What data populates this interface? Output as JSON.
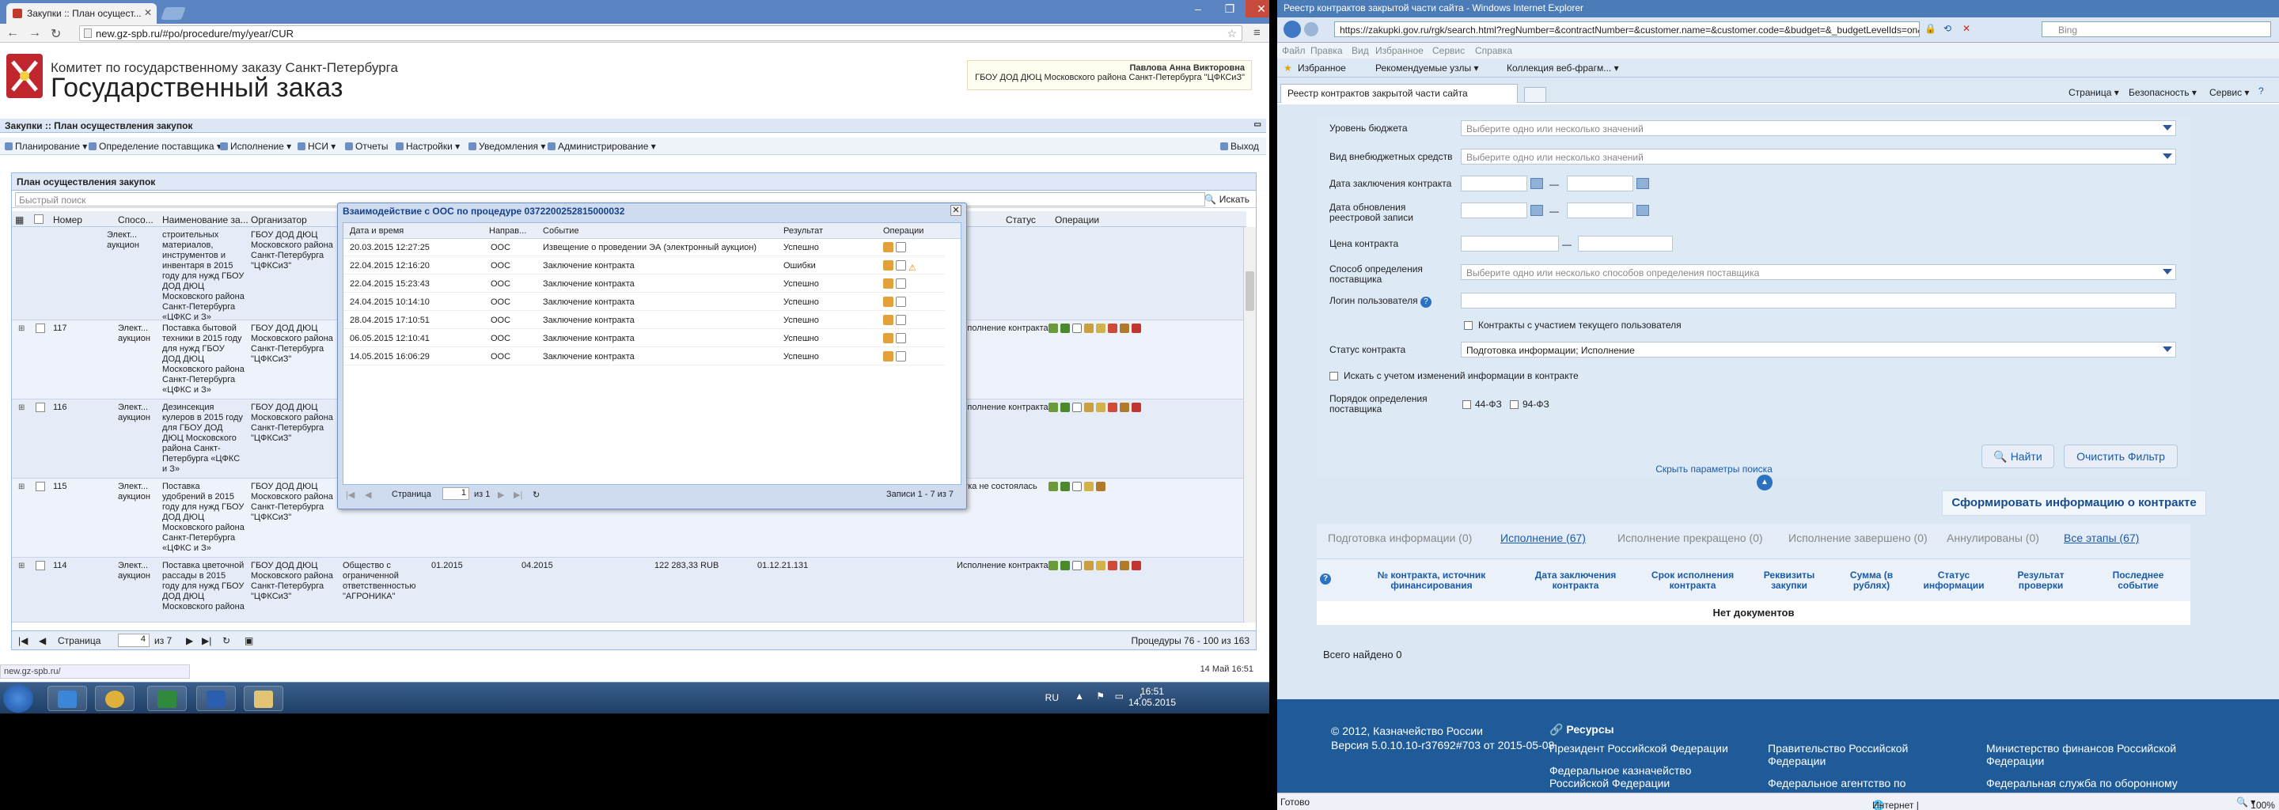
{
  "left_browser": {
    "tab_title": "Закупки :: План осущест...",
    "url": "new.gz-spb.ru/#po/procedure/my/year/CUR",
    "site": {
      "title_top": "Комитет по государственному заказу Санкт-Петербурга",
      "title_main": "Государственный заказ",
      "user_name": "Павлова Анна Викторовна",
      "user_org": "ГБОУ ДОД ДЮЦ Московского района Санкт-Петербурга \"ЦФКСиЗ\""
    },
    "app_title": "Закупки :: План осуществления закупок",
    "menu": [
      "Планирование",
      "Определение поставщика",
      "Исполнение",
      "НСИ",
      "Отчеты",
      "Настройки",
      "Уведомления",
      "Администрирование"
    ],
    "exit_label": "Выход",
    "panel_title": "План осуществления закупок",
    "quick_search_placeholder": "Быстрый поиск",
    "search_btn": "Искать",
    "grid_headers": [
      "Номер",
      "Спосо...",
      "Наименование за...",
      "Организатор",
      "Статус",
      "Операции"
    ],
    "rows": [
      {
        "num": "",
        "method": "Элект... аукцион",
        "name": "строительных материалов, инструментов и инвентаря в 2015 году для нужд ГБОУ ДОД ДЮЦ Московского района Санкт-Петербурга «ЦФКС и З»",
        "org": "ГБОУ ДОД ДЮЦ Московского района Санкт-Петербурга \"ЦФКСиЗ\"",
        "d1": "",
        "d2": "",
        "sum": "",
        "okpd": "",
        "status": ""
      },
      {
        "num": "117",
        "method": "Элект... аукцион",
        "name": "Поставка бытовой техники в 2015 году для нужд ГБОУ ДОД ДЮЦ Московского района Санкт-Петербурга «ЦФКС и З»",
        "org": "ГБОУ ДОД ДЮЦ Московского района Санкт-Петербурга \"ЦФКСиЗ\"",
        "d1": "",
        "d2": "",
        "sum": "",
        "okpd": "",
        "status": "Исполнение контракта"
      },
      {
        "num": "116",
        "method": "Элект... аукцион",
        "name": "Дезинсекция кулеров в 2015 году для ГБОУ ДОД ДЮЦ Московского района Санкт-Петербурга «ЦФКС и З»",
        "org": "ГБОУ ДОД ДЮЦ Московского района Санкт-Петербурга \"ЦФКСиЗ\"",
        "d1": "",
        "d2": "",
        "sum": "",
        "okpd": "",
        "status": "Исполнение контракта"
      },
      {
        "num": "115",
        "method": "Элект... аукцион",
        "name": "Поставка удобрений в 2015 году для нужд ГБОУ ДОД ДЮЦ Московского района Санкт-Петербурга «ЦФКС и З»",
        "org": "ГБОУ ДОД ДЮЦ Московского района Санкт-Петербурга \"ЦФКСиЗ\"",
        "d1": "",
        "d2": "",
        "sum": "",
        "okpd": "",
        "status": "...тка не состоялась"
      },
      {
        "num": "114",
        "method": "Элект... аукцион",
        "name": "Поставка цветочной рассады в 2015 году для нужд ГБОУ ДОД ДЮЦ Московского района",
        "org": "ГБОУ ДОД ДЮЦ Московского района Санкт-Петербурга \"ЦФКСиЗ\"",
        "supplier": "Общество с ограниченной ответственностью \"АГРОНИКА\"",
        "d1": "01.2015",
        "d2": "04.2015",
        "sum": "122 283,33 RUB",
        "okpd": "01.12.21.131",
        "status": "Исполнение контракта"
      }
    ],
    "pager": {
      "page_label": "Страница",
      "page": "4",
      "of": "из 7",
      "summary": "Процедуры 76 - 100 из 163"
    },
    "status_url": "new.gz-spb.ru/",
    "mini_clock": "14 Май 16:51"
  },
  "dialog": {
    "title": "Взаимодействие с ООС по процедуре 0372200252815000032",
    "headers": [
      "Дата и время",
      "Направ...",
      "Событие",
      "Результат",
      "Операции"
    ],
    "rows": [
      {
        "date": "20.03.2015 12:27:25",
        "dir": "ООС",
        "event": "Извещение о проведении ЭА (электронный аукцион)",
        "result": "Успешно",
        "warn": false
      },
      {
        "date": "22.04.2015 12:16:20",
        "dir": "ООС",
        "event": "Заключение контракта",
        "result": "Ошибки",
        "warn": true
      },
      {
        "date": "22.04.2015 15:23:43",
        "dir": "ООС",
        "event": "Заключение контракта",
        "result": "Успешно",
        "warn": false
      },
      {
        "date": "24.04.2015 10:14:10",
        "dir": "ООС",
        "event": "Заключение контракта",
        "result": "Успешно",
        "warn": false
      },
      {
        "date": "28.04.2015 17:10:51",
        "dir": "ООС",
        "event": "Заключение контракта",
        "result": "Успешно",
        "warn": false
      },
      {
        "date": "06.05.2015 12:10:41",
        "dir": "ООС",
        "event": "Заключение контракта",
        "result": "Успешно",
        "warn": false
      },
      {
        "date": "14.05.2015 16:06:29",
        "dir": "ООС",
        "event": "Заключение контракта",
        "result": "Успешно",
        "warn": false
      }
    ],
    "pager": {
      "page_label": "Страница",
      "page": "1",
      "of": "из 1",
      "summary": "Записи 1 - 7 из 7"
    }
  },
  "taskbar": {
    "lang": "RU",
    "time": "16:51",
    "date": "14.05.2015"
  },
  "right_browser": {
    "window_title": "Реестр контрактов закрытой части сайта - Windows Internet Explorer",
    "url": "https://zakupki.gov.ru/rgk/search.html?regNumber=&contractNumber=&customer.name=&customer.code=&budget=&_budgetLevelIds=on&...",
    "search_placeholder": "Bing",
    "menu": [
      "Файл",
      "Правка",
      "Вид",
      "Избранное",
      "Сервис",
      "Справка"
    ],
    "fav_label": "Избранное",
    "fav_links": [
      "Рекомендуемые узлы",
      "Коллекция веб-фрагм..."
    ],
    "tab_title": "Реестр контрактов закрытой части сайта",
    "cmd": [
      "Страница",
      "Безопасность",
      "Сервис"
    ],
    "filters": {
      "budget_level_label": "Уровень бюджета",
      "budget_level_ph": "Выберите одно или несколько значений",
      "offbudget_label": "Вид внебюджетных средств",
      "offbudget_ph": "Выберите одно или несколько значений",
      "sign_date_label": "Дата заключения контракта",
      "update_date_label": "Дата обновления реестровой записи",
      "price_label": "Цена контракта",
      "method_label": "Способ определения поставщика",
      "method_ph": "Выберите одно или несколько способов определения поставщика",
      "login_label": "Логин пользователя",
      "own_contracts_label": "Контракты с участием текущего пользователя",
      "status_label": "Статус контракта",
      "status_value": "Подготовка информации; Исполнение",
      "changes_label": "Искать с учетом изменений информации в контракте",
      "order_label": "Порядок определения поставщика",
      "law44": "44-ФЗ",
      "law94": "94-ФЗ",
      "dash": "—",
      "find_btn": "Найти",
      "clear_btn": "Очистить Фильтр",
      "hide_params": "Скрыть параметры поиска"
    },
    "form_info_btn": "Сформировать информацию о контракте",
    "status_tabs": [
      "Подготовка информации (0)",
      "Исполнение (67)",
      "Исполнение прекращено (0)",
      "Исполнение завершено (0)",
      "Аннулированы (0)",
      "Все этапы (67)"
    ],
    "result_headers": [
      "№ контракта, источник финансирования",
      "Дата заключения контракта",
      "Срок исполнения контракта",
      "Реквизиты закупки",
      "Сумма (в рублях)",
      "Статус информации",
      "Результат проверки",
      "Последнее событие"
    ],
    "no_docs": "Нет документов",
    "total": "Всего найдено 0",
    "footer": {
      "copyright": "© 2012, Казначейство России",
      "version": "Версия 5.0.10.10-r37692#703 от 2015-05-08",
      "resources": "Ресурсы",
      "links": [
        "Президент Российской Федерации",
        "Правительство Российской Федерации",
        "Министерство финансов Российской Федерации",
        "Федеральное казначейство Российской Федерации",
        "Федеральное агентство по",
        "Федеральная служба по оборонному"
      ]
    },
    "status": {
      "ready": "Готово",
      "zone": "Интернет | Защищенный режим: вкл.",
      "zoom": "100%"
    }
  }
}
